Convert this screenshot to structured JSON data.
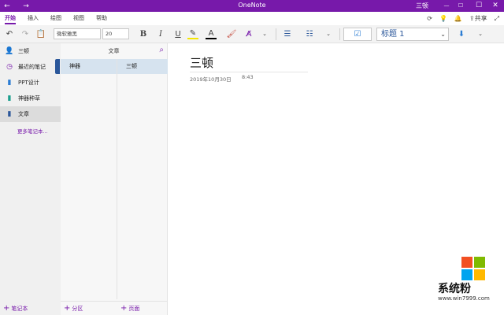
{
  "titlebar": {
    "back": "←",
    "forward": "→",
    "app_title": "OneNote",
    "user": "三顿",
    "minimize": "—",
    "maximize": "☐",
    "close": "✕"
  },
  "menu": {
    "tabs": [
      "开始",
      "插入",
      "绘图",
      "视图",
      "帮助"
    ],
    "active_tab": "开始",
    "share_label": "共享"
  },
  "ribbon": {
    "font_name": "微软雅黑",
    "font_size": "20",
    "bold": "B",
    "italic": "I",
    "underline": "U",
    "style": "标题 1"
  },
  "notebook_pane": {
    "user": "三顿",
    "items": [
      {
        "label": "最近的笔记",
        "icon": "clock-icon",
        "color": "#7719aa"
      },
      {
        "label": "PPT设计",
        "icon": "notebook-icon",
        "color": "#2b7cd3"
      },
      {
        "label": "神器种草",
        "icon": "notebook-icon",
        "color": "#1b9e8d"
      },
      {
        "label": "文章",
        "icon": "notebook-icon",
        "color": "#2b579a"
      }
    ],
    "selected": "文章",
    "more_notebooks": "更多笔记本...",
    "add_notebook": "笔记本"
  },
  "sections_pane": {
    "title": "文章",
    "sections": [
      "神器"
    ],
    "pages": [
      "三顿"
    ],
    "add_section": "分区",
    "add_page": "页面"
  },
  "page": {
    "title": "三顿",
    "date": "2019年10月30日",
    "time": "8:43"
  },
  "watermark": {
    "text": "系统粉",
    "url": "www.win7999.com",
    "colors": [
      "#f25022",
      "#7fba00",
      "#00a4ef",
      "#ffb900"
    ]
  },
  "colors": {
    "accent": "#7719aa",
    "section_tab": "#2b579a",
    "selected_row": "#d6e3ef"
  }
}
